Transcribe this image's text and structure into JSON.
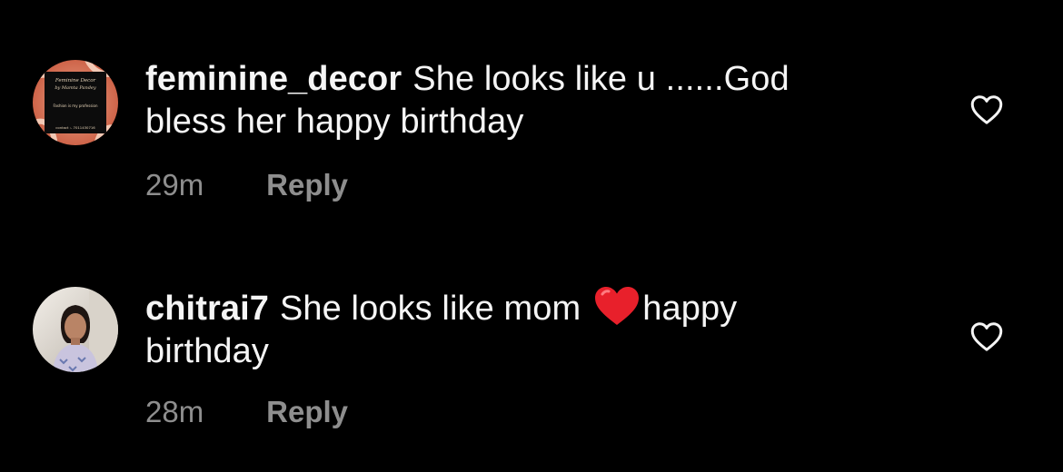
{
  "comments": [
    {
      "username": "feminine_decor",
      "text_line1": "She looks like u ......God",
      "text_line2": "bless her happy birthday",
      "timestamp": "29m",
      "reply_label": "Reply",
      "avatar": {
        "logo_line1": "Feminine Decor",
        "logo_line2": "by Mamta Pandey",
        "tagline": "Fashion is my profession",
        "contact": "contact :- 7011430716"
      },
      "like_icon": "heart-outline-icon"
    },
    {
      "username": "chitrai7",
      "text_before_emoji": "She looks like mom",
      "emoji": "red-heart-emoji",
      "text_after_emoji": "happy",
      "text_line2": "birthday",
      "timestamp": "28m",
      "reply_label": "Reply",
      "like_icon": "heart-outline-icon"
    }
  ],
  "colors": {
    "background": "#000000",
    "text": "#f5f5f5",
    "secondary_text": "#8e8e8e",
    "heart_emoji": "#e8202b"
  }
}
